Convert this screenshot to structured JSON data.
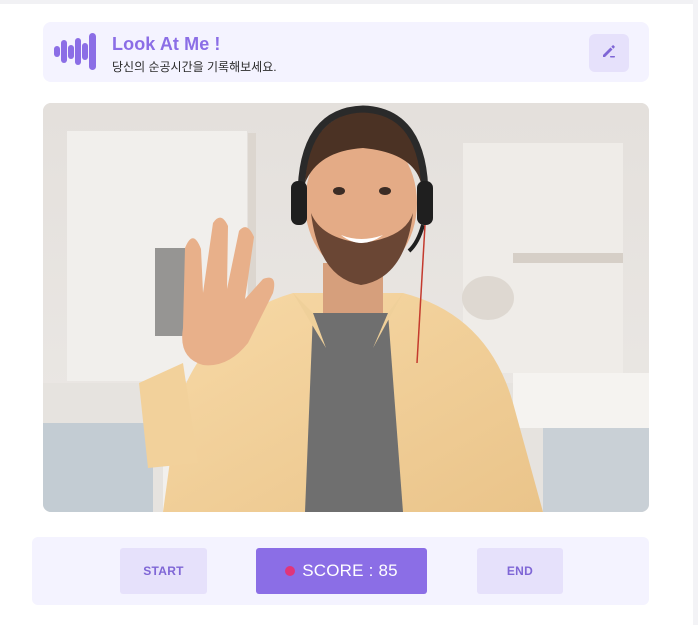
{
  "app": {
    "title": "Look At Me !",
    "subtitle": "당신의 순공시간을 기록해보세요."
  },
  "icons": {
    "logo": "sound-wave-logo-icon",
    "edit": "pencil-edit-icon",
    "recording": "recording-dot-icon"
  },
  "video": {
    "description_icon": "webcam-feed"
  },
  "controls": {
    "start_label": "START",
    "score_label": "SCORE : 85",
    "end_label": "END"
  },
  "colors": {
    "accent": "#8b6ee6",
    "accent_light": "#e6e1fb",
    "panel_bg": "#f4f3ff",
    "recording": "#e0357a"
  }
}
